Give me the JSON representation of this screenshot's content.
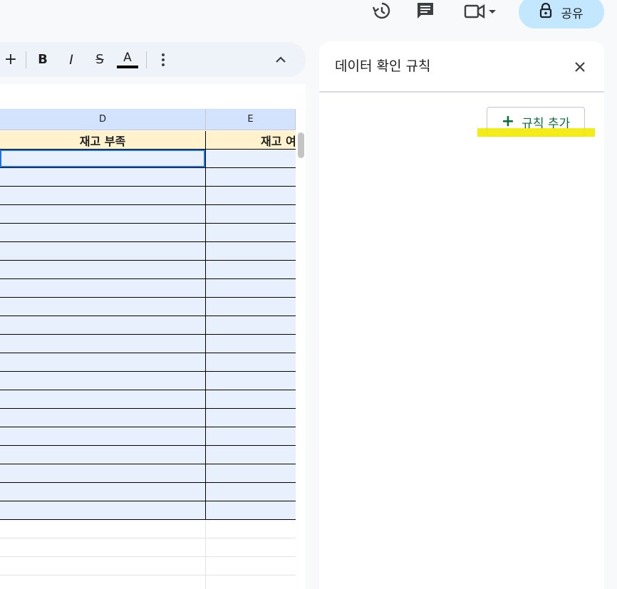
{
  "topbar": {
    "share_label": "공유",
    "icons": [
      "history-icon",
      "comment-icon",
      "video-call-icon",
      "lock-icon"
    ]
  },
  "toolbar": {
    "items": [
      "+",
      "B",
      "I",
      "S",
      "A"
    ],
    "text_color": "#000000"
  },
  "grid": {
    "columns": [
      {
        "label": "D"
      },
      {
        "label": "E"
      }
    ],
    "header_row": [
      "재고 부족",
      "재고 여"
    ],
    "data_rows": 20,
    "empty_rows": 4,
    "colors": {
      "col_header_bg": "#d3e3fd",
      "header_row_bg": "#fff2cc",
      "data_bg": "#e8f0fe",
      "selection": "#1a73e8"
    }
  },
  "panel": {
    "title": "데이터 확인 규칙",
    "add_rule_label": "규칙 추가",
    "add_rule_plus": "+",
    "accent": "#0b6b3a",
    "highlight": "#f2ea00"
  }
}
